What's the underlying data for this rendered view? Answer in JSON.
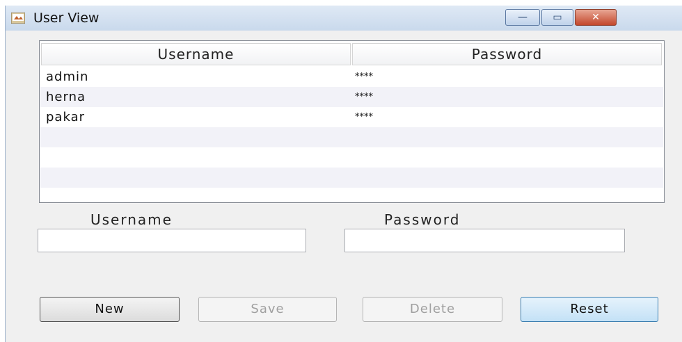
{
  "window": {
    "title": "User View",
    "controls": {
      "minimize": "—",
      "maximize": "▭",
      "close": "✕"
    }
  },
  "table": {
    "columns": [
      "Username",
      "Password"
    ],
    "rows": [
      {
        "username": "admin",
        "password": "****"
      },
      {
        "username": "herna",
        "password": "****"
      },
      {
        "username": "pakar",
        "password": "****"
      }
    ]
  },
  "form": {
    "username_label": "Username",
    "password_label": "Password",
    "username_value": "",
    "password_value": ""
  },
  "buttons": {
    "new": "New",
    "save": "Save",
    "delete": "Delete",
    "reset": "Reset"
  },
  "colors": {
    "accent": "#3c7fb1",
    "close_button": "#c3472c"
  }
}
